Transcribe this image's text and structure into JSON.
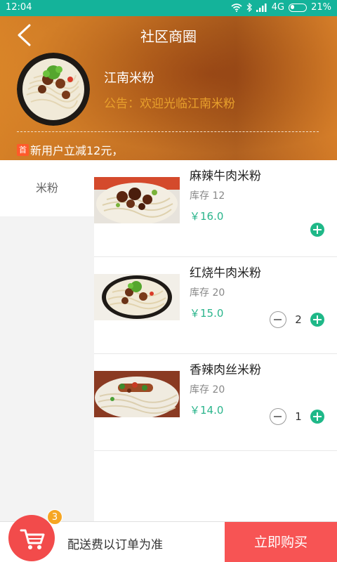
{
  "status_bar": {
    "time": "12:04",
    "network": "4G",
    "battery": "21%"
  },
  "header": {
    "title": "社区商圈",
    "shop_name": "江南米粉",
    "notice": "公告：欢迎光临江南米粉",
    "promo_badge": "首",
    "promo_text": "新用户立减12元，"
  },
  "categories": [
    {
      "label": "米粉"
    }
  ],
  "products": [
    {
      "name": "麻辣牛肉米粉",
      "stock": "库存 12",
      "price": "￥16.0",
      "quantity": ""
    },
    {
      "name": "红烧牛肉米粉",
      "stock": "库存 20",
      "price": "￥15.0",
      "quantity": "2"
    },
    {
      "name": "香辣肉丝米粉",
      "stock": "库存 20",
      "price": "￥14.0",
      "quantity": "1"
    }
  ],
  "bottom_bar": {
    "cart_count": "3",
    "delivery_note": "配送费以订单为准",
    "buy_label": "立即购买"
  },
  "colors": {
    "status_bar": "#14b39a",
    "accent_green": "#1fb888",
    "buy_red": "#f75454",
    "notice_orange": "#e8a02c"
  }
}
